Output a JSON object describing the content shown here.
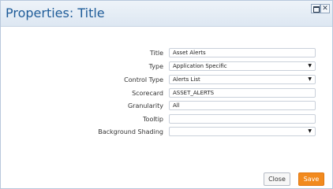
{
  "window": {
    "title": "Properties: Title",
    "maximize_glyph": "",
    "close_glyph": "✕"
  },
  "form": {
    "rows": [
      {
        "label": "Title",
        "value": "Asset Alerts",
        "kind": "text"
      },
      {
        "label": "Type",
        "value": "Application Specific",
        "kind": "select"
      },
      {
        "label": "Control Type",
        "value": "Alerts List",
        "kind": "select"
      },
      {
        "label": "Scorecard",
        "value": "ASSET_ALERTS",
        "kind": "text"
      },
      {
        "label": "Granularity",
        "value": "All",
        "kind": "text"
      },
      {
        "label": "Tooltip",
        "value": "",
        "kind": "text"
      },
      {
        "label": "Background Shading",
        "value": "",
        "kind": "select"
      }
    ],
    "dropdown_glyph": "▼"
  },
  "footer": {
    "close_label": "Close",
    "save_label": "Save",
    "save_color": "#f28a1e"
  }
}
